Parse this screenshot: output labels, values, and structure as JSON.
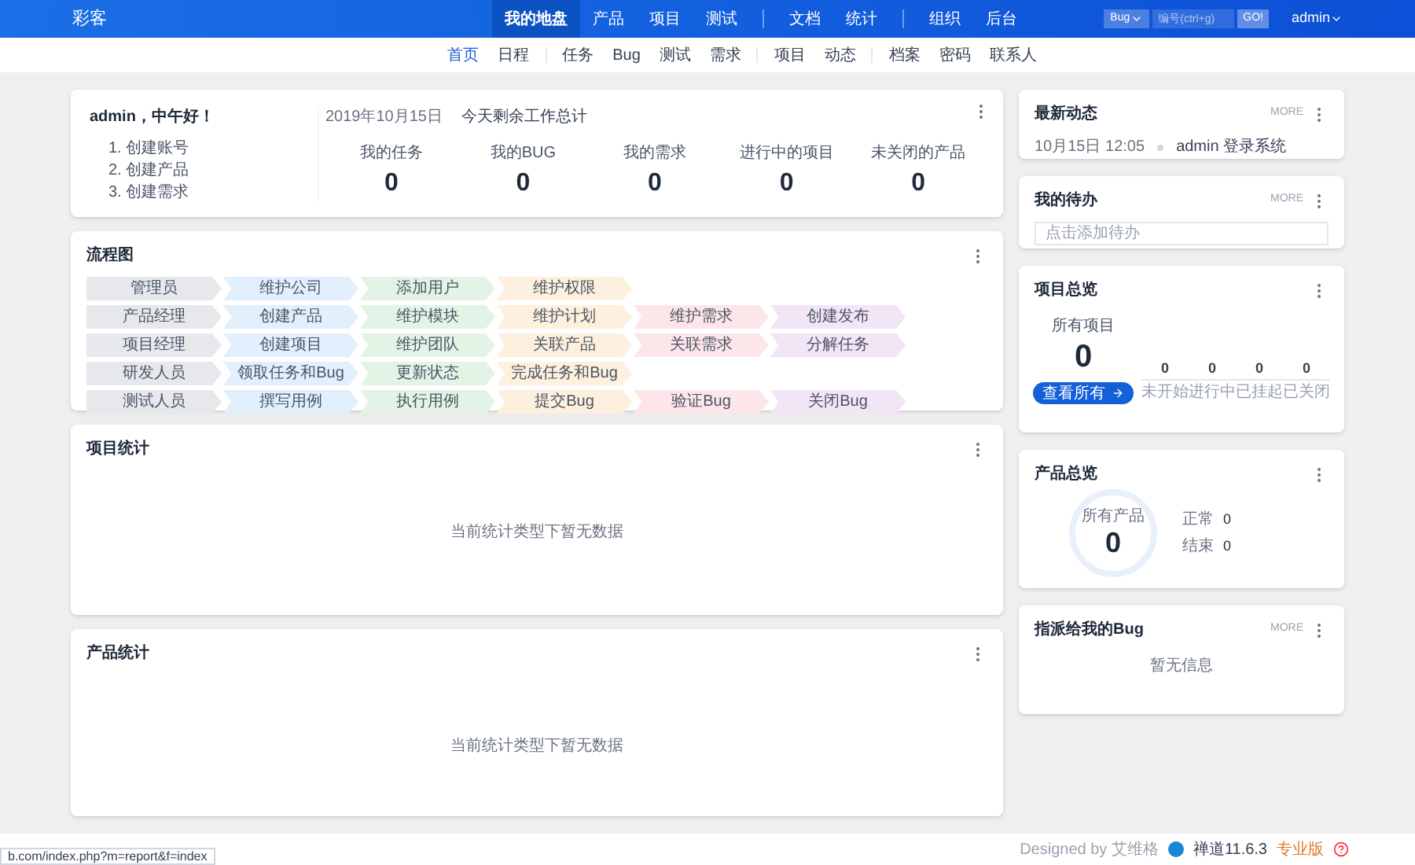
{
  "header": {
    "logo": "彩客",
    "nav": [
      {
        "label": "我的地盘",
        "selected": true
      },
      {
        "label": "产品",
        "selected": false
      },
      {
        "label": "项目",
        "selected": false
      },
      {
        "label": "测试",
        "selected": false
      },
      {
        "kind": "divider"
      },
      {
        "label": "文档",
        "selected": false
      },
      {
        "label": "统计",
        "selected": false
      },
      {
        "kind": "divider"
      },
      {
        "label": "组织",
        "selected": false
      },
      {
        "label": "后台",
        "selected": false
      }
    ],
    "search": {
      "type": "Bug",
      "placeholder": "编号(ctrl+g)",
      "button": "GO!"
    },
    "user": "admin"
  },
  "subnav": [
    {
      "label": "首页",
      "selected": true
    },
    {
      "label": "日程",
      "selected": false
    },
    {
      "kind": "divider"
    },
    {
      "label": "任务",
      "selected": false
    },
    {
      "label": "Bug",
      "selected": false
    },
    {
      "label": "测试",
      "selected": false
    },
    {
      "label": "需求",
      "selected": false
    },
    {
      "kind": "divider"
    },
    {
      "label": "项目",
      "selected": false
    },
    {
      "label": "动态",
      "selected": false
    },
    {
      "kind": "divider"
    },
    {
      "label": "档案",
      "selected": false
    },
    {
      "label": "密码",
      "selected": false
    },
    {
      "label": "联系人",
      "selected": false
    }
  ],
  "welcome": {
    "greeting": "admin，中午好！",
    "steps": [
      "1. 创建账号",
      "2. 创建产品",
      "3. 创建需求"
    ],
    "date": "2019年10月15日",
    "summary_title": "今天剩余工作总计",
    "stats": [
      {
        "label": "我的任务",
        "value": "0"
      },
      {
        "label": "我的BUG",
        "value": "0"
      },
      {
        "label": "我的需求",
        "value": "0"
      },
      {
        "label": "进行中的项目",
        "value": "0"
      },
      {
        "label": "未关闭的产品",
        "value": "0"
      }
    ]
  },
  "flowchart": {
    "title": "流程图",
    "rows": [
      [
        {
          "text": "管理员",
          "color": "#e6e8ec"
        },
        {
          "text": "维护公司",
          "color": "#e2effc"
        },
        {
          "text": "添加用户",
          "color": "#e3f4e6"
        },
        {
          "text": "维护权限",
          "color": "#fdf0de"
        }
      ],
      [
        {
          "text": "产品经理",
          "color": "#e6e8ec"
        },
        {
          "text": "创建产品",
          "color": "#e2effc"
        },
        {
          "text": "维护模块",
          "color": "#e3f4e6"
        },
        {
          "text": "维护计划",
          "color": "#fdf0de"
        },
        {
          "text": "维护需求",
          "color": "#fde6ea"
        },
        {
          "text": "创建发布",
          "color": "#f1e5f6"
        }
      ],
      [
        {
          "text": "项目经理",
          "color": "#e6e8ec"
        },
        {
          "text": "创建项目",
          "color": "#e2effc"
        },
        {
          "text": "维护团队",
          "color": "#e3f4e6"
        },
        {
          "text": "关联产品",
          "color": "#fdf0de"
        },
        {
          "text": "关联需求",
          "color": "#fde6ea"
        },
        {
          "text": "分解任务",
          "color": "#f1e5f6"
        }
      ],
      [
        {
          "text": "研发人员",
          "color": "#e6e8ec"
        },
        {
          "text": "领取任务和Bug",
          "color": "#e2effc"
        },
        {
          "text": "更新状态",
          "color": "#e3f4e6"
        },
        {
          "text": "完成任务和Bug",
          "color": "#fdf0de"
        }
      ],
      [
        {
          "text": "测试人员",
          "color": "#e6e8ec"
        },
        {
          "text": "撰写用例",
          "color": "#e2effc"
        },
        {
          "text": "执行用例",
          "color": "#e3f4e6"
        },
        {
          "text": "提交Bug",
          "color": "#fdf0de"
        },
        {
          "text": "验证Bug",
          "color": "#fde6ea"
        },
        {
          "text": "关闭Bug",
          "color": "#f1e5f6"
        }
      ]
    ]
  },
  "project_stats": {
    "title": "项目统计",
    "empty": "当前统计类型下暂无数据"
  },
  "product_stats": {
    "title": "产品统计",
    "empty": "当前统计类型下暂无数据"
  },
  "dynamics": {
    "title": "最新动态",
    "more": "MORE",
    "entries": [
      {
        "time": "10月15日 12:05",
        "text": "admin 登录系统"
      }
    ]
  },
  "todo": {
    "title": "我的待办",
    "more": "MORE",
    "placeholder": "点击添加待办"
  },
  "project_overview": {
    "title": "项目总览",
    "total_label": "所有项目",
    "total": "0",
    "button": "查看所有",
    "stats": [
      {
        "value": "0",
        "label": "未开始"
      },
      {
        "value": "0",
        "label": "进行中"
      },
      {
        "value": "0",
        "label": "已挂起"
      },
      {
        "value": "0",
        "label": "已关闭"
      }
    ]
  },
  "product_overview": {
    "title": "产品总览",
    "total_label": "所有产品",
    "total": "0",
    "stats": [
      {
        "label": "正常",
        "value": "0"
      },
      {
        "label": "结束",
        "value": "0"
      }
    ]
  },
  "assigned_bugs": {
    "title": "指派给我的Bug",
    "more": "MORE",
    "empty": "暂无信息"
  },
  "footer": {
    "status_url": "b.com/index.php?m=report&f=index",
    "designed_by": "Designed by 艾维格",
    "version": "禅道11.6.3",
    "edition": "专业版"
  }
}
